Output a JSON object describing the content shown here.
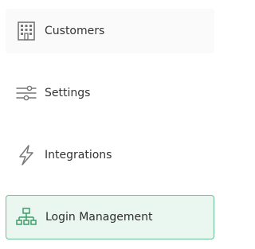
{
  "nav": {
    "items": [
      {
        "label": "Customers",
        "icon": "building-icon",
        "state": "hovered"
      },
      {
        "label": "Settings",
        "icon": "sliders-icon",
        "state": "normal"
      },
      {
        "label": "Integrations",
        "icon": "lightning-icon",
        "state": "normal"
      },
      {
        "label": "Login Management",
        "icon": "sitemap-icon",
        "state": "active"
      }
    ]
  },
  "colors": {
    "icon_gray": "#777777",
    "active_green": "#3f9d6a",
    "active_bg": "#eaf6f0",
    "active_border": "#6fbf95",
    "text": "#333333"
  }
}
